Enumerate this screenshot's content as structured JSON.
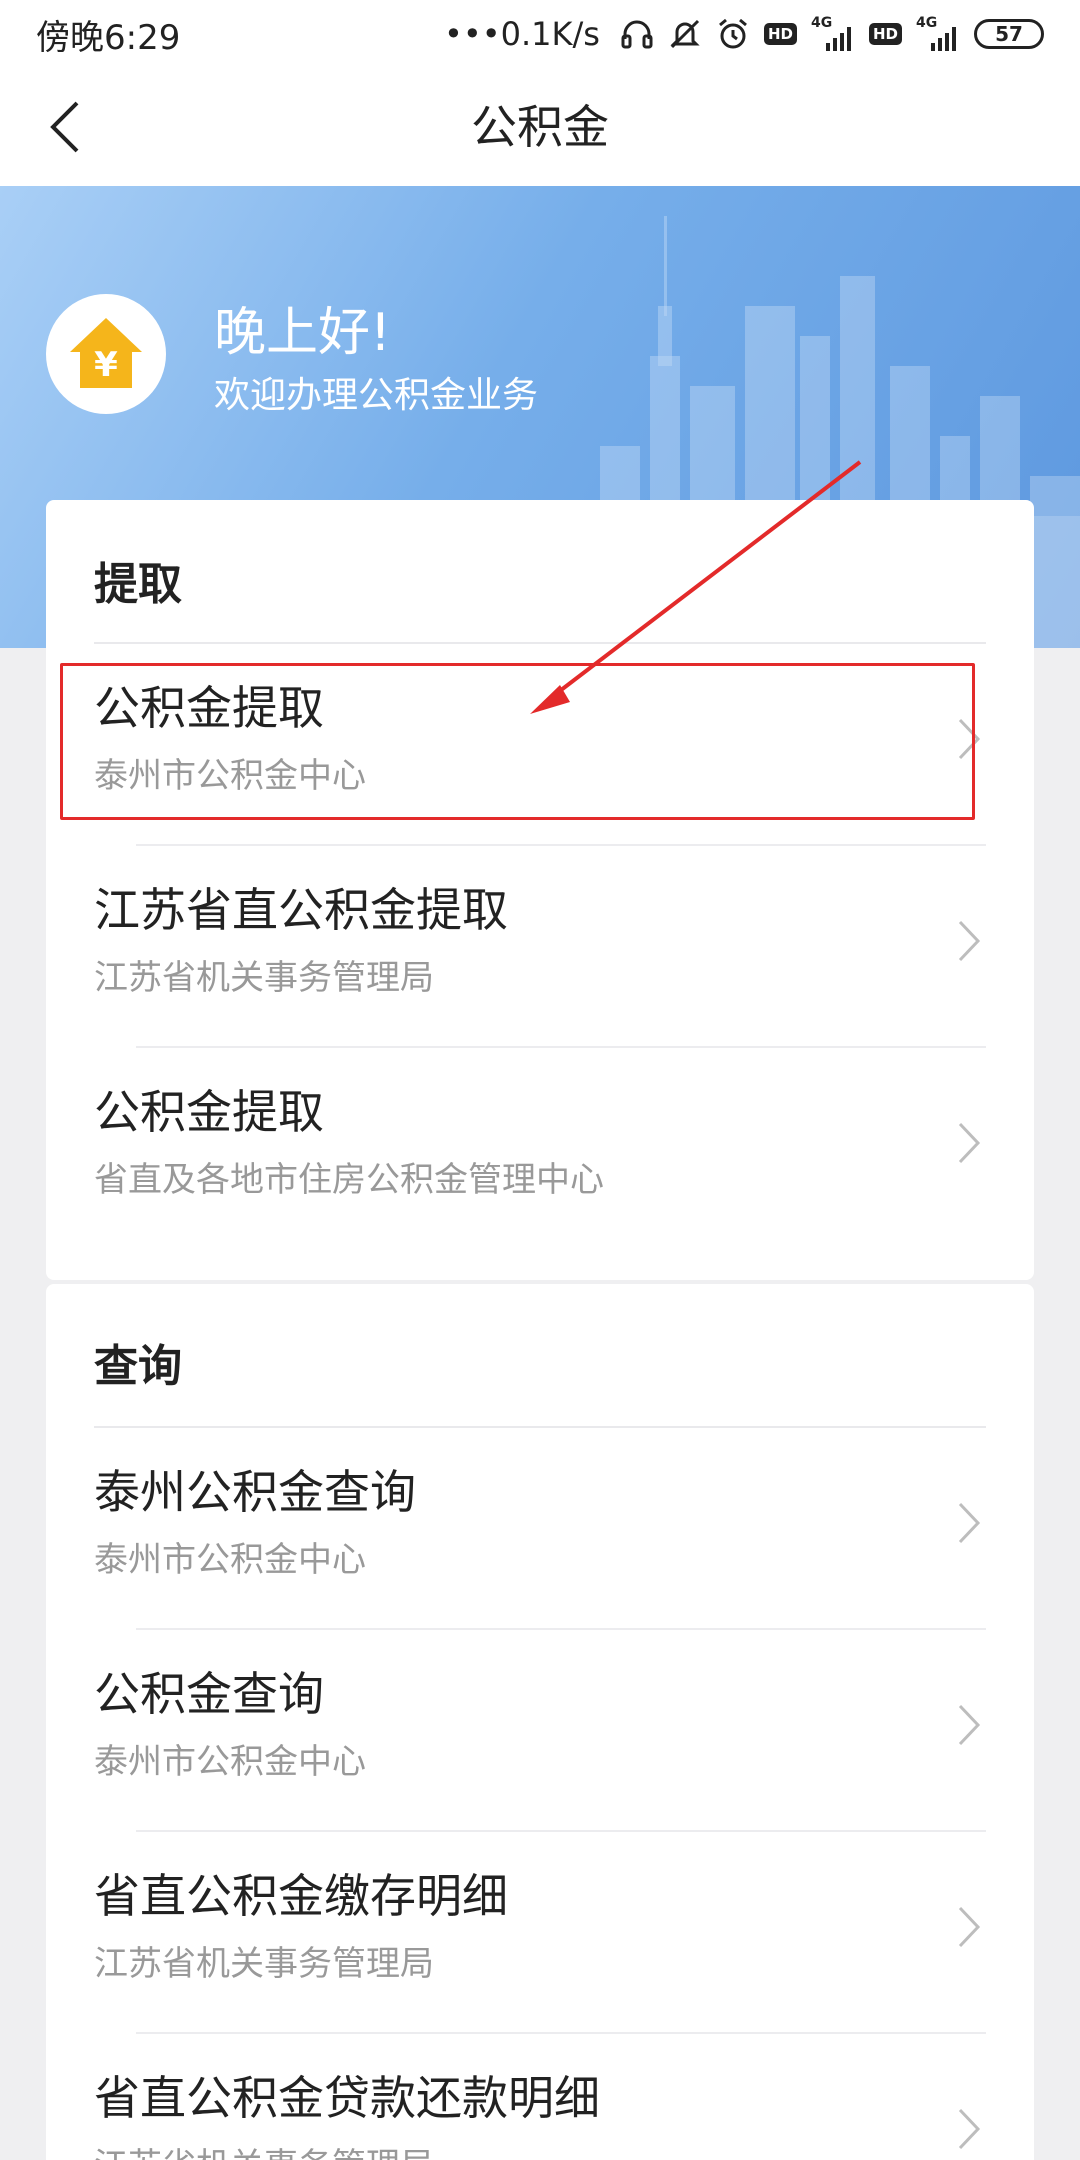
{
  "status_bar": {
    "time": "傍晚6:29",
    "network_speed": "•••0.1K/s",
    "hd_badge": "HD",
    "signal_tag": "4G",
    "battery": "57",
    "icons": [
      "headset-icon",
      "mute-bell-icon",
      "alarm-icon",
      "hd-icon",
      "signal-icon",
      "battery-icon"
    ]
  },
  "nav": {
    "title": "公积金",
    "back_icon": "chevron-left-icon"
  },
  "hero": {
    "greeting": "晚上好!",
    "subtitle": "欢迎办理公积金业务",
    "logo_icon": "house-yen-icon",
    "colors": {
      "accent": "#f5b51b",
      "banner": "#6fa6e6"
    }
  },
  "sections": [
    {
      "title": "提取",
      "items": [
        {
          "title": "公积金提取",
          "subtitle": "泰州市公积金中心"
        },
        {
          "title": "江苏省直公积金提取",
          "subtitle": "江苏省机关事务管理局"
        },
        {
          "title": "公积金提取",
          "subtitle": "省直及各地市住房公积金管理中心"
        }
      ]
    },
    {
      "title": "查询",
      "items": [
        {
          "title": "泰州公积金查询",
          "subtitle": "泰州市公积金中心"
        },
        {
          "title": "公积金查询",
          "subtitle": "泰州市公积金中心"
        },
        {
          "title": "省直公积金缴存明细",
          "subtitle": "江苏省机关事务管理局"
        },
        {
          "title": "省直公积金贷款还款明细",
          "subtitle": "江苏省机关事务管理局"
        }
      ]
    }
  ],
  "annotation": {
    "color": "#e32a2a",
    "target": "sections.0.items.0"
  }
}
